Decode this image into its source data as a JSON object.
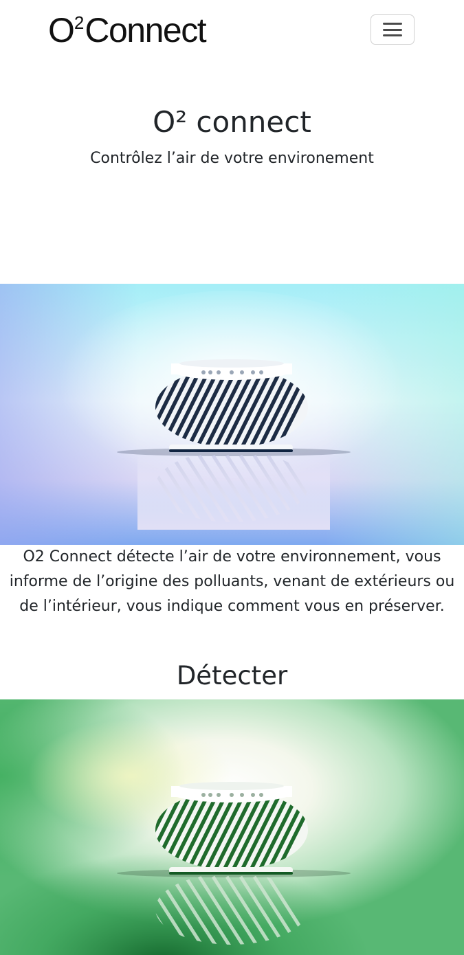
{
  "navbar": {
    "brand_o": "O",
    "brand_sup": "2",
    "brand_rest": "Connect",
    "toggler_icon": "hamburger-menu-icon"
  },
  "hero": {
    "title": "O² connect",
    "subtitle": "Contrôlez l’air de votre environement"
  },
  "description": "O2 Connect détecte l’air de votre environnement, vous informe de l’origine des polluants, venant de extérieurs ou de l’intérieur, vous indique comment vous en préserver.",
  "section": {
    "title": "Détecter"
  },
  "colors": {
    "accent_blue": "#8fe6f0",
    "accent_purple": "#9aa0f0",
    "accent_green": "#2f9a4e",
    "text": "#212529"
  }
}
